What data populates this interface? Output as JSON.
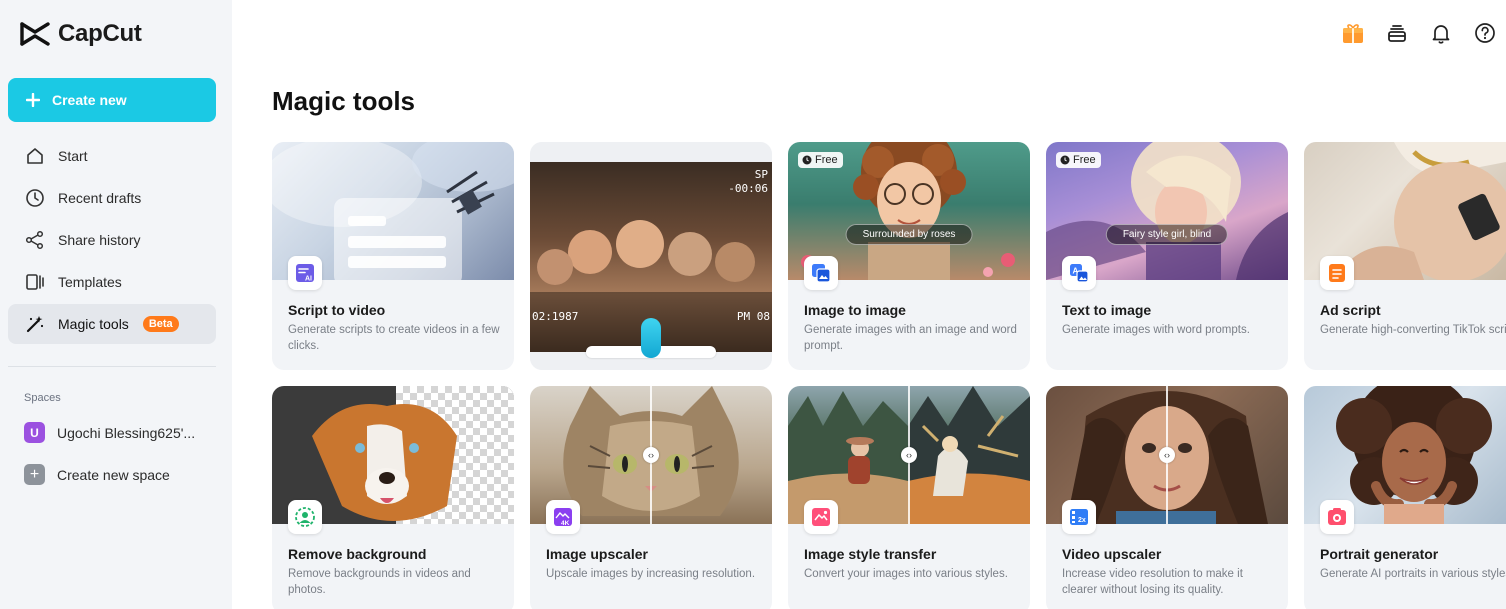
{
  "app": {
    "name": "CapCut"
  },
  "sidebar": {
    "create_label": "Create new",
    "items": [
      {
        "label": "Start",
        "icon": "home-icon"
      },
      {
        "label": "Recent drafts",
        "icon": "clock-icon"
      },
      {
        "label": "Share history",
        "icon": "share-icon"
      },
      {
        "label": "Templates",
        "icon": "templates-icon"
      },
      {
        "label": "Magic tools",
        "icon": "magic-wand-icon",
        "badge": "Beta"
      }
    ],
    "spaces_title": "Spaces",
    "space_avatar": "U",
    "space_name": "Ugochi Blessing625'...",
    "create_space_label": "Create new space"
  },
  "main": {
    "title": "Magic tools",
    "cards": [
      {
        "title": "Script to video",
        "desc": "Generate scripts to create videos in a few clicks.",
        "icon": "script-ai-icon"
      },
      {
        "title": "",
        "desc": "",
        "icon": ""
      },
      {
        "title": "Image to image",
        "desc": "Generate images with an image and word prompt.",
        "badge": "Free",
        "prompt": "Surrounded by roses",
        "icon": "image-to-image-icon"
      },
      {
        "title": "Text to image",
        "desc": "Generate images with word prompts.",
        "badge": "Free",
        "prompt": "Fairy style girl, blind",
        "icon": "text-to-image-icon"
      },
      {
        "title": "Ad script",
        "desc": "Generate high-converting TikTok scripts.",
        "icon": "ad-script-icon"
      },
      {
        "title": "Remove background",
        "desc": "Remove backgrounds in videos and photos.",
        "icon": "remove-background-icon"
      },
      {
        "title": "Image upscaler",
        "desc": "Upscale images by increasing resolution.",
        "icon": "upscale-4k-icon"
      },
      {
        "title": "Image style transfer",
        "desc": "Convert your images into various styles.",
        "icon": "style-transfer-icon"
      },
      {
        "title": "Video upscaler",
        "desc": "Increase video resolution to make it clearer without losing its quality.",
        "icon": "video-upscale-icon"
      },
      {
        "title": "Portrait generator",
        "desc": "Generate AI portraits in various styles.",
        "icon": "portrait-icon"
      }
    ],
    "video_overlay": {
      "time_left": "02:1987",
      "time_right": "PM 08",
      "top_right": "SP",
      "top_right2": "-00:06"
    }
  },
  "colors": {
    "accent": "#1bc9e4",
    "beta": "#ff7a1a",
    "sidebar_bg": "#f3f5f8",
    "card_bg": "#f2f4f7"
  }
}
